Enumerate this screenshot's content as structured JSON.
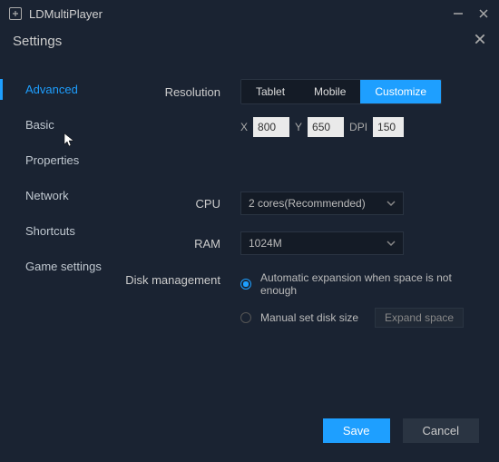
{
  "titlebar": {
    "app_name": "LDMultiPlayer"
  },
  "header": {
    "title": "Settings"
  },
  "sidebar": {
    "items": [
      {
        "label": "Advanced"
      },
      {
        "label": "Basic"
      },
      {
        "label": "Properties"
      },
      {
        "label": "Network"
      },
      {
        "label": "Shortcuts"
      },
      {
        "label": "Game settings"
      }
    ]
  },
  "content": {
    "resolution_label": "Resolution",
    "res_tabs": {
      "tablet": "Tablet",
      "mobile": "Mobile",
      "customize": "Customize"
    },
    "dims": {
      "x_label": "X",
      "x_value": "800",
      "y_label": "Y",
      "y_value": "650",
      "dpi_label": "DPI",
      "dpi_value": "150"
    },
    "cpu_label": "CPU",
    "cpu_value": "2 cores(Recommended)",
    "ram_label": "RAM",
    "ram_value": "1024M",
    "disk_label": "Disk management",
    "disk_auto": "Automatic expansion when space is not enough",
    "disk_manual": "Manual set disk size",
    "expand_btn": "Expand space"
  },
  "footer": {
    "save": "Save",
    "cancel": "Cancel"
  }
}
